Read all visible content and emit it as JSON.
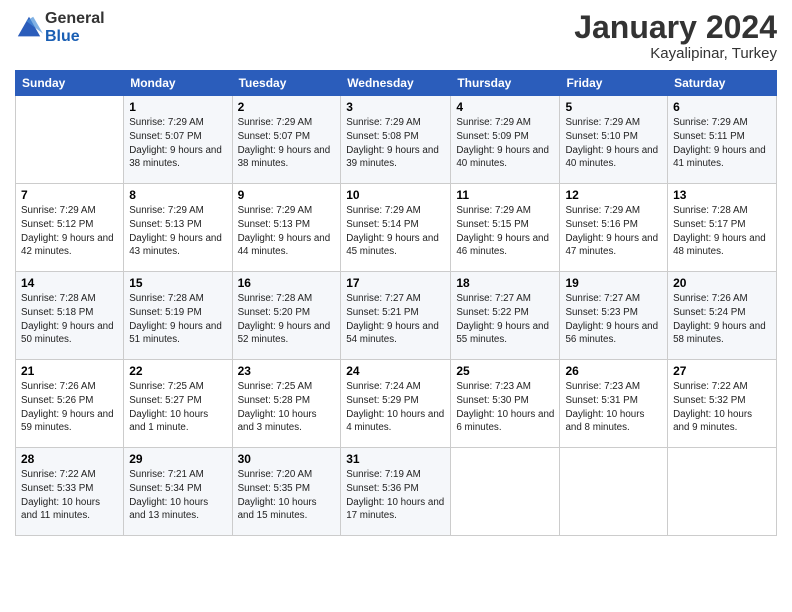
{
  "header": {
    "logo_line1": "General",
    "logo_line2": "Blue",
    "month": "January 2024",
    "location": "Kayalipinar, Turkey"
  },
  "days_of_week": [
    "Sunday",
    "Monday",
    "Tuesday",
    "Wednesday",
    "Thursday",
    "Friday",
    "Saturday"
  ],
  "weeks": [
    [
      {
        "day": "",
        "sunrise": "",
        "sunset": "",
        "daylight": ""
      },
      {
        "day": "1",
        "sunrise": "7:29 AM",
        "sunset": "5:07 PM",
        "daylight": "9 hours and 38 minutes."
      },
      {
        "day": "2",
        "sunrise": "7:29 AM",
        "sunset": "5:07 PM",
        "daylight": "9 hours and 38 minutes."
      },
      {
        "day": "3",
        "sunrise": "7:29 AM",
        "sunset": "5:08 PM",
        "daylight": "9 hours and 39 minutes."
      },
      {
        "day": "4",
        "sunrise": "7:29 AM",
        "sunset": "5:09 PM",
        "daylight": "9 hours and 40 minutes."
      },
      {
        "day": "5",
        "sunrise": "7:29 AM",
        "sunset": "5:10 PM",
        "daylight": "9 hours and 40 minutes."
      },
      {
        "day": "6",
        "sunrise": "7:29 AM",
        "sunset": "5:11 PM",
        "daylight": "9 hours and 41 minutes."
      }
    ],
    [
      {
        "day": "7",
        "sunrise": "7:29 AM",
        "sunset": "5:12 PM",
        "daylight": "9 hours and 42 minutes."
      },
      {
        "day": "8",
        "sunrise": "7:29 AM",
        "sunset": "5:13 PM",
        "daylight": "9 hours and 43 minutes."
      },
      {
        "day": "9",
        "sunrise": "7:29 AM",
        "sunset": "5:13 PM",
        "daylight": "9 hours and 44 minutes."
      },
      {
        "day": "10",
        "sunrise": "7:29 AM",
        "sunset": "5:14 PM",
        "daylight": "9 hours and 45 minutes."
      },
      {
        "day": "11",
        "sunrise": "7:29 AM",
        "sunset": "5:15 PM",
        "daylight": "9 hours and 46 minutes."
      },
      {
        "day": "12",
        "sunrise": "7:29 AM",
        "sunset": "5:16 PM",
        "daylight": "9 hours and 47 minutes."
      },
      {
        "day": "13",
        "sunrise": "7:28 AM",
        "sunset": "5:17 PM",
        "daylight": "9 hours and 48 minutes."
      }
    ],
    [
      {
        "day": "14",
        "sunrise": "7:28 AM",
        "sunset": "5:18 PM",
        "daylight": "9 hours and 50 minutes."
      },
      {
        "day": "15",
        "sunrise": "7:28 AM",
        "sunset": "5:19 PM",
        "daylight": "9 hours and 51 minutes."
      },
      {
        "day": "16",
        "sunrise": "7:28 AM",
        "sunset": "5:20 PM",
        "daylight": "9 hours and 52 minutes."
      },
      {
        "day": "17",
        "sunrise": "7:27 AM",
        "sunset": "5:21 PM",
        "daylight": "9 hours and 54 minutes."
      },
      {
        "day": "18",
        "sunrise": "7:27 AM",
        "sunset": "5:22 PM",
        "daylight": "9 hours and 55 minutes."
      },
      {
        "day": "19",
        "sunrise": "7:27 AM",
        "sunset": "5:23 PM",
        "daylight": "9 hours and 56 minutes."
      },
      {
        "day": "20",
        "sunrise": "7:26 AM",
        "sunset": "5:24 PM",
        "daylight": "9 hours and 58 minutes."
      }
    ],
    [
      {
        "day": "21",
        "sunrise": "7:26 AM",
        "sunset": "5:26 PM",
        "daylight": "9 hours and 59 minutes."
      },
      {
        "day": "22",
        "sunrise": "7:25 AM",
        "sunset": "5:27 PM",
        "daylight": "10 hours and 1 minute."
      },
      {
        "day": "23",
        "sunrise": "7:25 AM",
        "sunset": "5:28 PM",
        "daylight": "10 hours and 3 minutes."
      },
      {
        "day": "24",
        "sunrise": "7:24 AM",
        "sunset": "5:29 PM",
        "daylight": "10 hours and 4 minutes."
      },
      {
        "day": "25",
        "sunrise": "7:23 AM",
        "sunset": "5:30 PM",
        "daylight": "10 hours and 6 minutes."
      },
      {
        "day": "26",
        "sunrise": "7:23 AM",
        "sunset": "5:31 PM",
        "daylight": "10 hours and 8 minutes."
      },
      {
        "day": "27",
        "sunrise": "7:22 AM",
        "sunset": "5:32 PM",
        "daylight": "10 hours and 9 minutes."
      }
    ],
    [
      {
        "day": "28",
        "sunrise": "7:22 AM",
        "sunset": "5:33 PM",
        "daylight": "10 hours and 11 minutes."
      },
      {
        "day": "29",
        "sunrise": "7:21 AM",
        "sunset": "5:34 PM",
        "daylight": "10 hours and 13 minutes."
      },
      {
        "day": "30",
        "sunrise": "7:20 AM",
        "sunset": "5:35 PM",
        "daylight": "10 hours and 15 minutes."
      },
      {
        "day": "31",
        "sunrise": "7:19 AM",
        "sunset": "5:36 PM",
        "daylight": "10 hours and 17 minutes."
      },
      {
        "day": "",
        "sunrise": "",
        "sunset": "",
        "daylight": ""
      },
      {
        "day": "",
        "sunrise": "",
        "sunset": "",
        "daylight": ""
      },
      {
        "day": "",
        "sunrise": "",
        "sunset": "",
        "daylight": ""
      }
    ]
  ]
}
